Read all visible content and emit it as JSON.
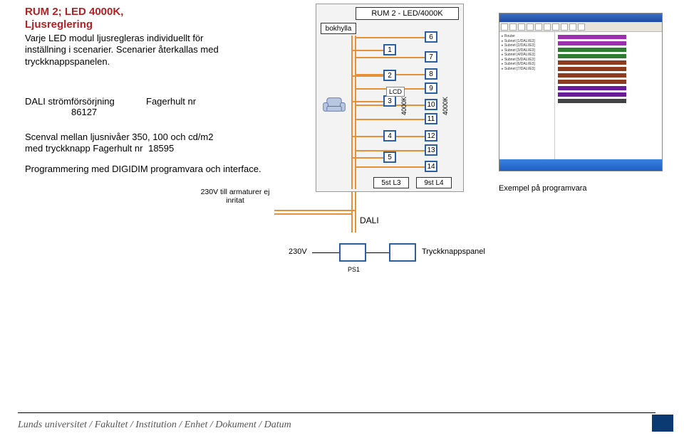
{
  "heading": {
    "title_line1": "RUM 2;  LED 4000K,",
    "title_line2": "Ljusreglering",
    "paragraph": "Varje LED modul ljusregleras individuellt för inställning i scenarier. Scenarier återkallas med tryckknappspanelen."
  },
  "dali": {
    "label": "DALI strömförsörjning",
    "supplier": "Fagerhult nr",
    "number": "86127"
  },
  "scenval": {
    "line1": "Scenval mellan ljusnivåer 350, 100 och cd/m2",
    "line2a": "med tryckknapp Fagerhult nr",
    "line2b": "18595"
  },
  "programming": "Programmering med DIGIDIM programvara och interface.",
  "note_230v": "230V till armaturer ej inritat",
  "diagram": {
    "title": "RUM 2 - LED/4000K",
    "bokhylla": "bokhylla",
    "lcd": "LCD",
    "vlabel_left": "4000K",
    "vlabel_right": "4000K",
    "boxes_left": [
      "1",
      "2",
      "3",
      "4",
      "5"
    ],
    "boxes_right": [
      "6",
      "7",
      "8",
      "9",
      "10",
      "11",
      "12",
      "13",
      "14"
    ],
    "bottom_left": "5st L3",
    "bottom_right": "9st L4"
  },
  "software": {
    "caption": "Exempel på programvara",
    "tree_items": [
      "Router",
      "Subnet [1/DALI/E3]",
      "Subnet [2/DALI/E3]",
      "Subnet [3/DALI/E3]",
      "Subnet [4/DALI/E3]",
      "Subnet [5/DALI/E3]",
      "Subnet [6/DALI/E3]",
      "Subnet [7/DALI/E3]"
    ],
    "bar_colors": [
      "#9b2fae",
      "#9b2fae",
      "#2e7d32",
      "#2e7d32",
      "#8e3b1f",
      "#8e3b1f",
      "#8e3b1f",
      "#8e3b1f",
      "#6a1b9a",
      "#6a1b9a",
      "#424242"
    ]
  },
  "lower": {
    "dali_label": "DALI",
    "v230": "230V",
    "ps1": "PS1",
    "panel": "Tryckknappspanel"
  },
  "footer": "Lunds universitet / Fakultet / Institution / Enhet / Dokument / Datum"
}
